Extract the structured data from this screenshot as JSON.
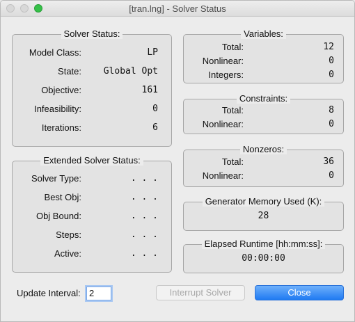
{
  "window": {
    "title": "[tran.lng] - Solver Status"
  },
  "solver_status": {
    "title": "Solver Status:",
    "rows": [
      {
        "label": "Model Class:",
        "value": "LP"
      },
      {
        "label": "State:",
        "value": "Global Opt"
      },
      {
        "label": "Objective:",
        "value": "161"
      },
      {
        "label": "Infeasibility:",
        "value": "0"
      },
      {
        "label": "Iterations:",
        "value": "6"
      }
    ]
  },
  "extended_status": {
    "title": "Extended Solver Status:",
    "rows": [
      {
        "label": "Solver Type:",
        "value": ". . ."
      },
      {
        "label": "Best Obj:",
        "value": ". . ."
      },
      {
        "label": "Obj Bound:",
        "value": ". . ."
      },
      {
        "label": "Steps:",
        "value": ". . ."
      },
      {
        "label": "Active:",
        "value": ". . ."
      }
    ]
  },
  "variables": {
    "title": "Variables:",
    "rows": [
      {
        "label": "Total:",
        "value": "12"
      },
      {
        "label": "Nonlinear:",
        "value": "0"
      },
      {
        "label": "Integers:",
        "value": "0"
      }
    ]
  },
  "constraints": {
    "title": "Constraints:",
    "rows": [
      {
        "label": "Total:",
        "value": "8"
      },
      {
        "label": "Nonlinear:",
        "value": "0"
      }
    ]
  },
  "nonzeros": {
    "title": "Nonzeros:",
    "rows": [
      {
        "label": "Total:",
        "value": "36"
      },
      {
        "label": "Nonlinear:",
        "value": "0"
      }
    ]
  },
  "memory": {
    "title": "Generator Memory Used (K):",
    "value": "28"
  },
  "runtime": {
    "title": "Elapsed Runtime [hh:mm:ss]:",
    "value": "00:00:00"
  },
  "footer": {
    "update_interval_label": "Update Interval:",
    "update_interval_value": "2",
    "interrupt_label": "Interrupt Solver",
    "close_label": "Close"
  }
}
